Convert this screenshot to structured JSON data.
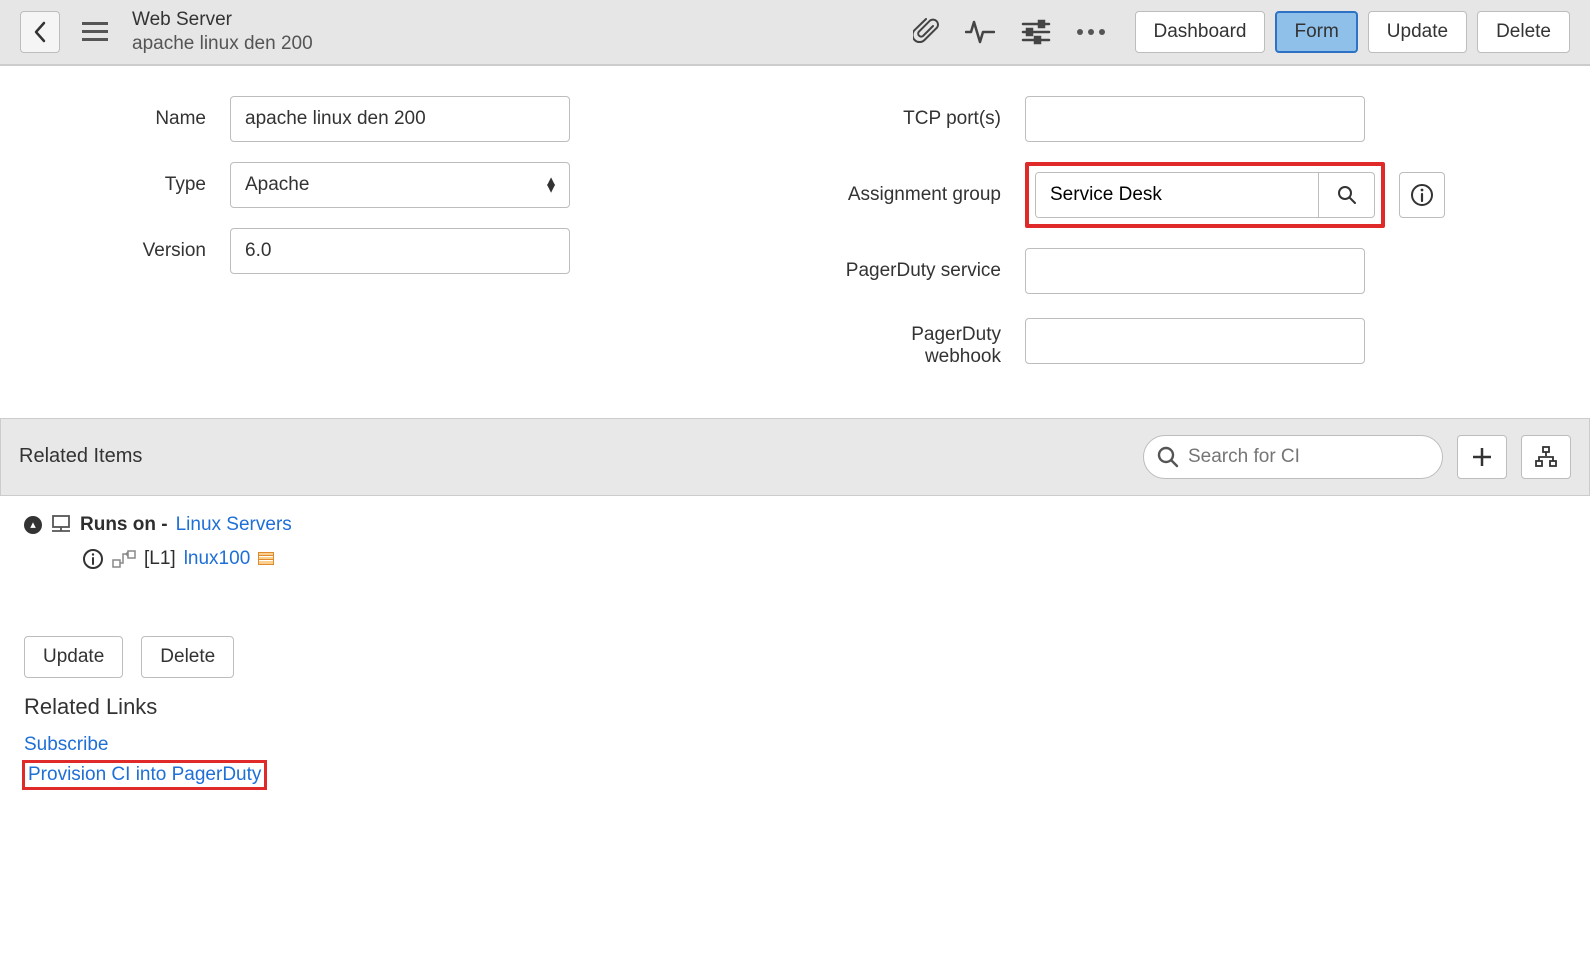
{
  "header": {
    "title": "Web Server",
    "subtitle": "apache linux den 200",
    "buttons": {
      "dashboard": "Dashboard",
      "form": "Form",
      "update": "Update",
      "delete": "Delete"
    }
  },
  "form": {
    "left": {
      "name_label": "Name",
      "name_value": "apache linux den 200",
      "type_label": "Type",
      "type_value": "Apache",
      "version_label": "Version",
      "version_value": "6.0"
    },
    "right": {
      "tcp_label": "TCP port(s)",
      "tcp_value": "",
      "assignment_label": "Assignment group",
      "assignment_value": "Service Desk",
      "pd_service_label": "PagerDuty service",
      "pd_service_value": "",
      "pd_webhook_label_1": "PagerDuty",
      "pd_webhook_label_2": "webhook",
      "pd_webhook_value": ""
    }
  },
  "related_bar": {
    "title": "Related Items",
    "search_placeholder": "Search for CI"
  },
  "related_items": {
    "runs_on_prefix": "Runs on -",
    "runs_on_link": "Linux Servers",
    "child_level": "[L1]",
    "child_link": "lnux100"
  },
  "bottom": {
    "update": "Update",
    "delete": "Delete"
  },
  "related_links": {
    "heading": "Related Links",
    "subscribe": "Subscribe",
    "provision": "Provision CI into PagerDuty"
  }
}
